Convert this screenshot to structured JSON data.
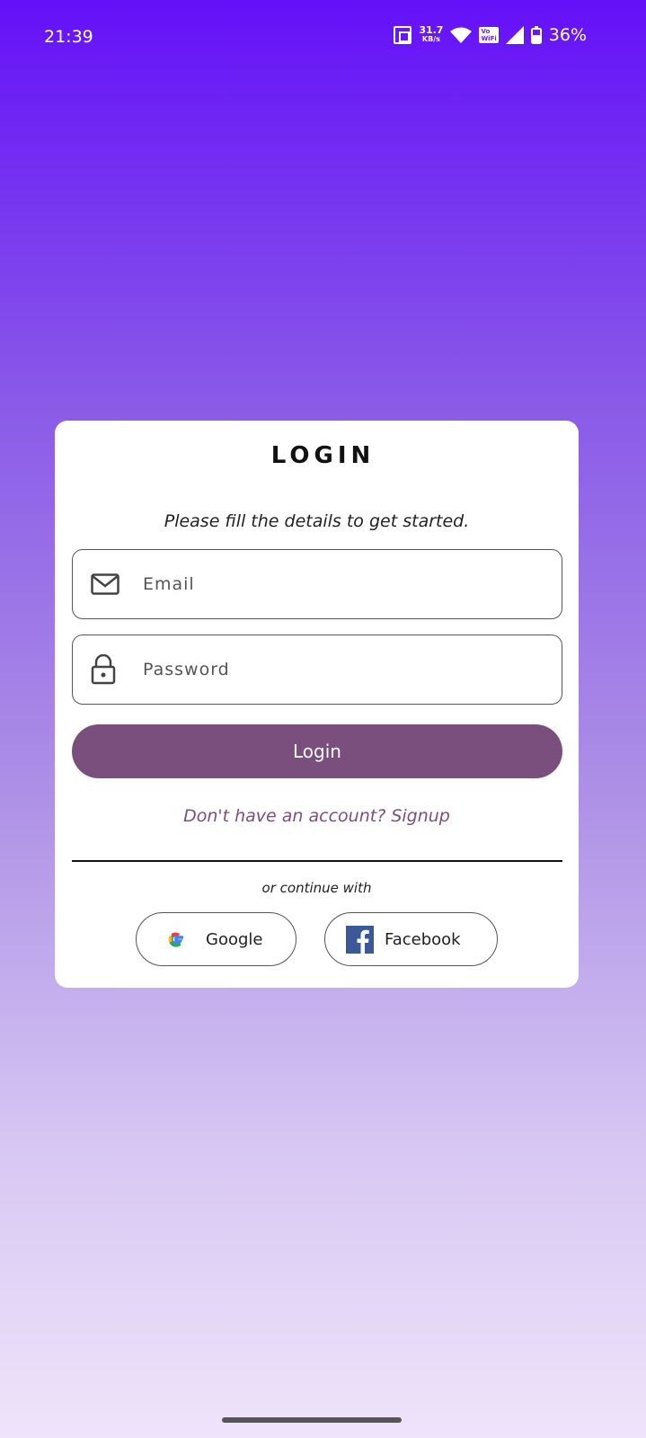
{
  "status_bar": {
    "time": "21:39",
    "speed_value": "31.7",
    "speed_unit": "KB/s",
    "vowifi_top": "Vo",
    "vowifi_bottom": "WiFi",
    "battery": "36%"
  },
  "login": {
    "title": "LOGIN",
    "subtitle": "Please fill the details to get started.",
    "email_placeholder": "Email",
    "email_value": "",
    "password_placeholder": "Password",
    "password_value": "",
    "login_button": "Login",
    "signup_link": "Don't have an account? Signup",
    "divider_text": "or continue with",
    "google_button": "Google",
    "facebook_button": "Facebook"
  },
  "colors": {
    "accent": "#7a4f7e",
    "gradient_top": "#6410f8",
    "gradient_bottom": "#efe4fa",
    "facebook": "#3b5998"
  }
}
